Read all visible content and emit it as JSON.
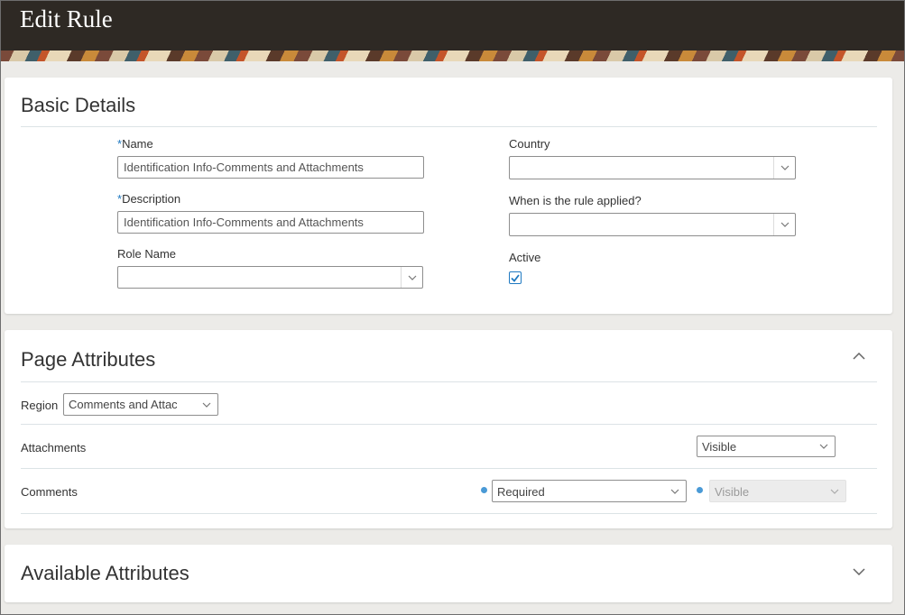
{
  "header": {
    "title": "Edit Rule"
  },
  "basic_details": {
    "title": "Basic Details",
    "name": {
      "label": "Name",
      "required_mark": "*",
      "value": "Identification Info-Comments and Attachments"
    },
    "description": {
      "label": "Description",
      "required_mark": "*",
      "value": "Identification Info-Comments and Attachments"
    },
    "role_name": {
      "label": "Role Name",
      "value": ""
    },
    "country": {
      "label": "Country",
      "value": ""
    },
    "when_applied": {
      "label": "When is the rule applied?",
      "value": ""
    },
    "active": {
      "label": "Active",
      "checked": true
    }
  },
  "page_attributes": {
    "title": "Page Attributes",
    "region": {
      "label": "Region",
      "value": "Comments and Attachme"
    },
    "rows": [
      {
        "label": "Attachments",
        "visibility": "Visible"
      },
      {
        "label": "Comments",
        "requirement": "Required",
        "visibility": "Visible"
      }
    ]
  },
  "available_attributes": {
    "title": "Available Attributes"
  },
  "icons": {
    "collapse": "chevron-up-icon",
    "expand": "chevron-down-icon",
    "dropdown": "chevron-down-icon",
    "checkmark": "checkmark-icon"
  },
  "colors": {
    "header_bg": "#2e2924",
    "accent": "#1f79c1"
  }
}
